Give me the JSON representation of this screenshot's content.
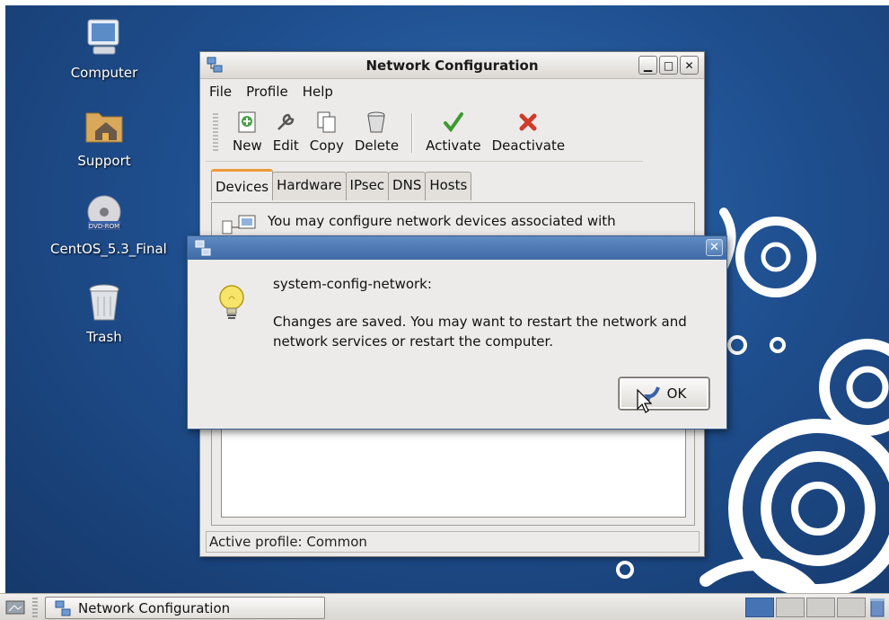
{
  "desktop": {
    "icons": [
      {
        "label": "Computer",
        "icon": "computer-icon"
      },
      {
        "label": "Support",
        "icon": "folder-home-icon"
      },
      {
        "label": "CentOS_5.3_Final",
        "icon": "dvd-rom-icon",
        "badge": "DVD-ROM"
      },
      {
        "label": "Trash",
        "icon": "trash-icon"
      }
    ]
  },
  "window": {
    "title": "Network Configuration",
    "menu": {
      "file": "File",
      "profile": "Profile",
      "help": "Help"
    },
    "toolbar": {
      "new": "New",
      "edit": "Edit",
      "copy": "Copy",
      "delete": "Delete",
      "activate": "Activate",
      "deactivate": "Deactivate"
    },
    "tabs": [
      "Devices",
      "Hardware",
      "IPsec",
      "DNS",
      "Hosts"
    ],
    "active_tab": "Devices",
    "panel_text": "You may configure network devices associated with",
    "status": "Active profile: Common"
  },
  "dialog": {
    "heading": "system-config-network:",
    "message": "Changes are saved. You may want to restart the network and network services or restart the computer.",
    "ok_label": "OK"
  },
  "taskbar": {
    "task_label": "Network Configuration"
  },
  "colors": {
    "desktop_blue": "#1f4f8f",
    "dialog_title_blue": "#3f6aa6",
    "tab_accent": "#ee9a38",
    "workspace_active": "#4573b4"
  }
}
